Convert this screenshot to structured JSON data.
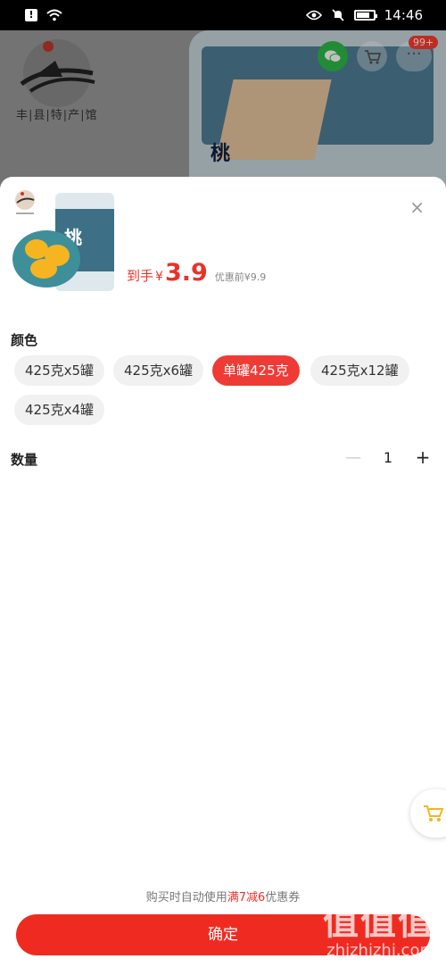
{
  "status_bar": {
    "time": "14:46",
    "alert_glyph": "!"
  },
  "background": {
    "logo_text": "丰|县|特|产|馆",
    "badge": "99+",
    "more_glyph": "···",
    "product_brand": "桃"
  },
  "sheet": {
    "close_glyph": "×",
    "price": {
      "prefix": "到手",
      "symbol": "¥",
      "value": "3.9",
      "original": "优惠前¥9.9"
    },
    "color_section": {
      "title": "颜色",
      "options": [
        {
          "label": "425克x5罐",
          "selected": false
        },
        {
          "label": "425克x6罐",
          "selected": false
        },
        {
          "label": "单罐425克",
          "selected": true
        },
        {
          "label": "425克x12罐",
          "selected": false
        },
        {
          "label": "425克x4罐",
          "selected": false
        }
      ]
    },
    "quantity": {
      "label": "数量",
      "minus": "—",
      "value": "1",
      "plus": "+"
    },
    "coupon_note": {
      "before": "购买时自动使用",
      "highlight": "满7减6",
      "after": "优惠券"
    },
    "confirm_label": "确定",
    "watermark": {
      "big": "值值值",
      "small": "zhizhizhi.com"
    }
  },
  "colors": {
    "accent": "#ef3b36",
    "confirm": "#ef2b21",
    "wechat": "#2dbb47",
    "cart_icon": "#f6b520"
  }
}
